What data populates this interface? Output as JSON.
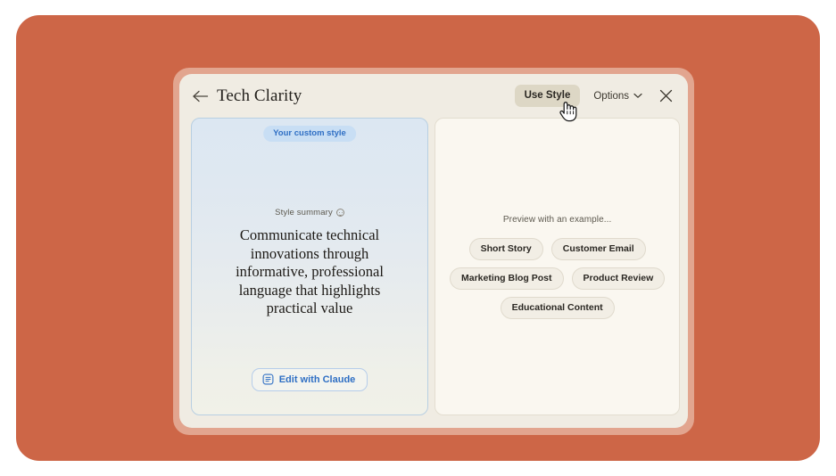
{
  "header": {
    "back_icon": "arrow-left-icon",
    "title": "Tech Clarity",
    "use_style_label": "Use Style",
    "options_label": "Options",
    "options_chevron_icon": "chevron-down-icon",
    "close_icon": "close-icon"
  },
  "left_panel": {
    "badge": "Your custom style",
    "summary_label": "Style summary",
    "summary_info_icon": "info-circle-icon",
    "summary_text": "Communicate technical innovations through informative, professional language that highlights practical value",
    "edit_button_label": "Edit with Claude",
    "edit_button_icon": "chat-bubble-icon"
  },
  "right_panel": {
    "preview_label": "Preview with an example...",
    "chip_rows": [
      [
        "Short Story",
        "Customer Email"
      ],
      [
        "Marketing Blog Post",
        "Product Review"
      ],
      [
        "Educational Content"
      ]
    ]
  },
  "cursor": {
    "icon": "pointing-hand-cursor"
  },
  "colors": {
    "canvas_background": "#cd6647",
    "modal_background": "#f0ece3",
    "accent_blue": "#2f6fc4",
    "badge_background": "#c8def4",
    "use_style_background": "#ddd7c5",
    "right_panel_background": "#faf7f0"
  }
}
